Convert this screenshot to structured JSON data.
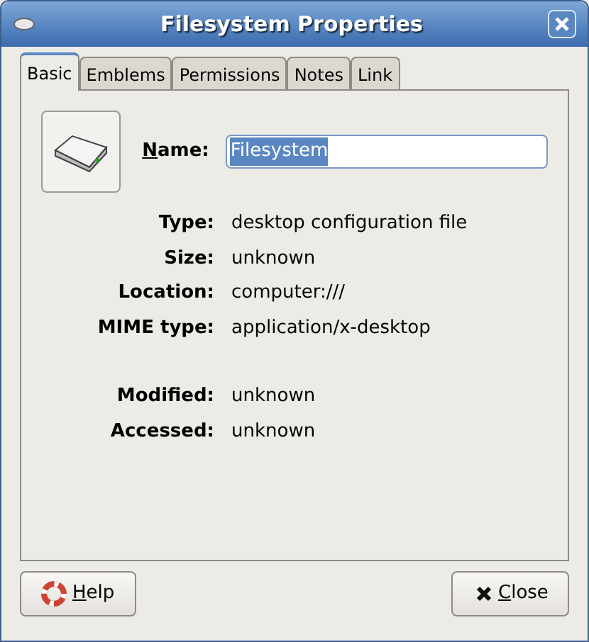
{
  "window": {
    "title": "Filesystem Properties"
  },
  "tabs": [
    {
      "label": "Basic",
      "selected": true
    },
    {
      "label": "Emblems",
      "selected": false
    },
    {
      "label": "Permissions",
      "selected": false
    },
    {
      "label": "Notes",
      "selected": false
    },
    {
      "label": "Link",
      "selected": false
    }
  ],
  "name_field": {
    "label": "Name:",
    "value": "Filesystem",
    "selected": true
  },
  "properties": [
    {
      "label": "Type:",
      "value": "desktop configuration file"
    },
    {
      "label": "Size:",
      "value": "unknown"
    },
    {
      "label": "Location:",
      "value": "computer:///"
    },
    {
      "label": "MIME type:",
      "value": "application/x-desktop"
    },
    {
      "label": "Modified:",
      "value": "unknown",
      "gap_before": true
    },
    {
      "label": "Accessed:",
      "value": "unknown"
    }
  ],
  "buttons": [
    {
      "kind": "help",
      "label": "Help"
    },
    {
      "kind": "close",
      "label": "Close"
    }
  ]
}
